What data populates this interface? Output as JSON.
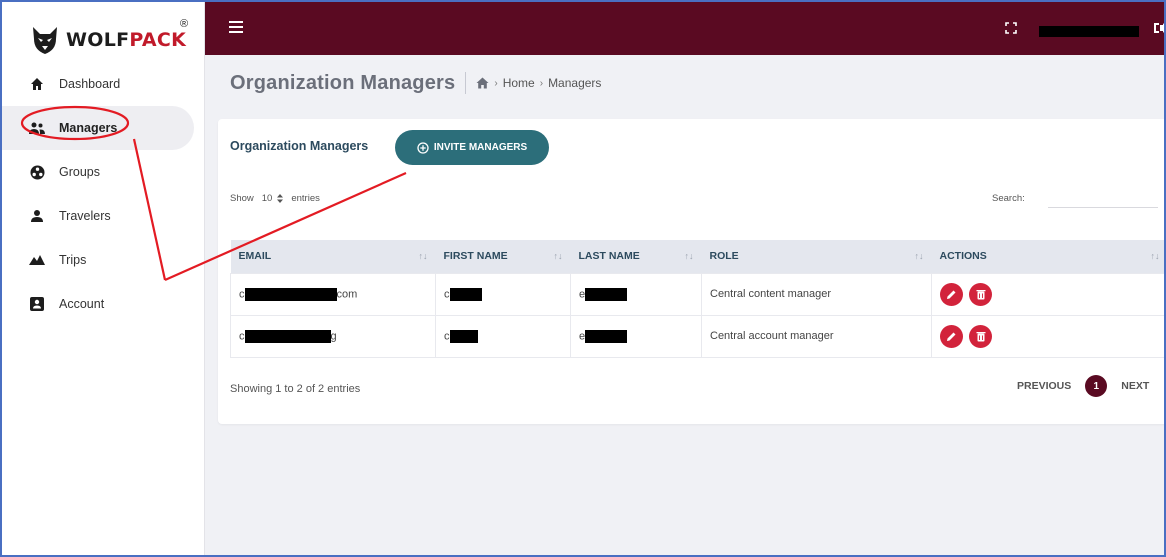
{
  "brand": {
    "name_part1": "WOLF",
    "name_part2": "PACK",
    "registered": "®"
  },
  "sidebar": {
    "items": [
      {
        "label": "Dashboard",
        "icon": "home-icon"
      },
      {
        "label": "Managers",
        "icon": "managers-icon",
        "active": true
      },
      {
        "label": "Groups",
        "icon": "groups-icon"
      },
      {
        "label": "Travelers",
        "icon": "traveler-icon"
      },
      {
        "label": "Trips",
        "icon": "trips-icon"
      },
      {
        "label": "Account",
        "icon": "account-icon"
      }
    ]
  },
  "topbar": {
    "bg_color": "#5a0a22",
    "user_name_redacted": ""
  },
  "header": {
    "title": "Organization Managers",
    "crumb_home": "Home",
    "crumb_current": "Managers",
    "crumb_sep": "›"
  },
  "card": {
    "title": "Organization Managers",
    "invite_label": "INVITE MANAGERS",
    "invite_color": "#2c6e7a",
    "show_label": "Show",
    "entries_value": "10",
    "entries_label": "entries",
    "search_label": "Search:",
    "search_value": ""
  },
  "table": {
    "columns": [
      "EMAIL",
      "FIRST NAME",
      "LAST NAME",
      "ROLE",
      "ACTIONS"
    ],
    "rows": [
      {
        "email_prefix": "c",
        "email_suffix": "com",
        "first_prefix": "c",
        "last_prefix": "e",
        "role": "Central content manager"
      },
      {
        "email_prefix": "c",
        "email_suffix": "g",
        "first_prefix": "c",
        "last_prefix": "e",
        "role": "Central account manager"
      }
    ]
  },
  "footer": {
    "showing_text": "Showing 1 to 2 of 2 entries",
    "prev_label": "PREVIOUS",
    "current_page": "1",
    "next_label": "NEXT"
  },
  "colors": {
    "accent_red": "#d2233b",
    "annotation_red": "#e31b23"
  }
}
